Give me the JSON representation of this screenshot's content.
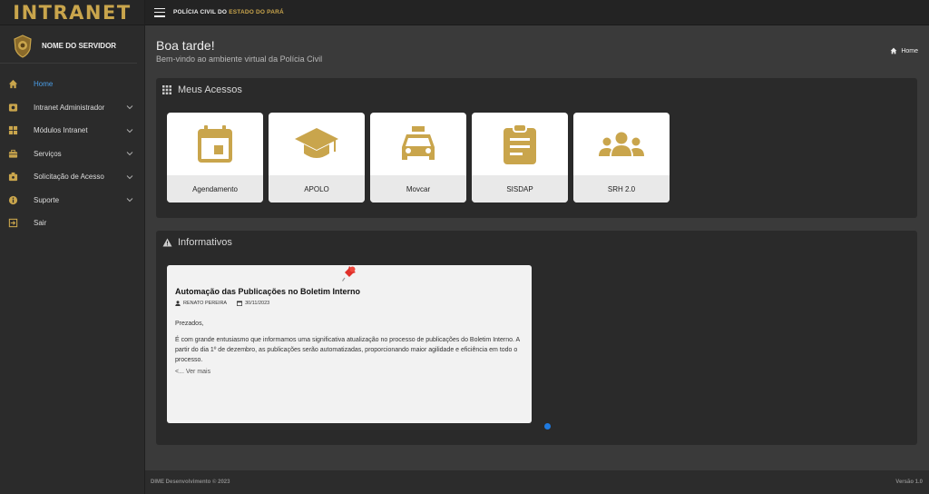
{
  "brand": {
    "title": "INTRANET",
    "accent_color": "#c9a54c"
  },
  "user": {
    "name": "NOME DO SERVIDOR",
    "avatar_icon": "police-badge-icon"
  },
  "sidebar": {
    "items": [
      {
        "label": "Home",
        "icon": "home-icon",
        "active": true,
        "has_chevron": false
      },
      {
        "label": "Intranet Administrador",
        "icon": "admin-icon",
        "has_chevron": true
      },
      {
        "label": "Módulos Intranet",
        "icon": "modules-icon",
        "has_chevron": true
      },
      {
        "label": "Serviços",
        "icon": "briefcase-icon",
        "has_chevron": true
      },
      {
        "label": "Solicitação de Acesso",
        "icon": "access-request-icon",
        "has_chevron": true
      },
      {
        "label": "Suporte",
        "icon": "info-icon",
        "has_chevron": true
      },
      {
        "label": "Sair",
        "icon": "logout-icon",
        "has_chevron": false
      }
    ]
  },
  "topbar": {
    "title_main": "POLÍCIA CIVIL DO ",
    "title_accent": "ESTADO DO PARÁ"
  },
  "header": {
    "greeting": "Boa tarde!",
    "subtitle": "Bem-vindo ao ambiente virtual da Polícia Civil",
    "breadcrumb": "Home"
  },
  "acessos": {
    "title": "Meus Acessos",
    "tiles": [
      {
        "label": "Agendamento",
        "icon": "calendar-icon"
      },
      {
        "label": "APOLO",
        "icon": "graduation-cap-icon"
      },
      {
        "label": "Movcar",
        "icon": "car-icon"
      },
      {
        "label": "SISDAP",
        "icon": "clipboard-icon"
      },
      {
        "label": "SRH 2.0",
        "icon": "people-icon"
      }
    ]
  },
  "informativos": {
    "title": "Informativos",
    "post": {
      "title": "Automação das Publicações no Boletim Interno",
      "author": "RENATO PEREIRA",
      "date": "30/11/2023",
      "greeting": "Prezados,",
      "body": "É com grande entusiasmo que informamos uma significativa atualização no processo de publicações do Boletim Interno. A partir do dia 1º de dezembro, as publicações serão automatizadas, proporcionando maior agilidade e eficiência em todo o processo.",
      "more": "<... Ver mais"
    }
  },
  "footer": {
    "left": "DIME Desenvolvimento © 2023",
    "right": "Versão 1.0"
  }
}
